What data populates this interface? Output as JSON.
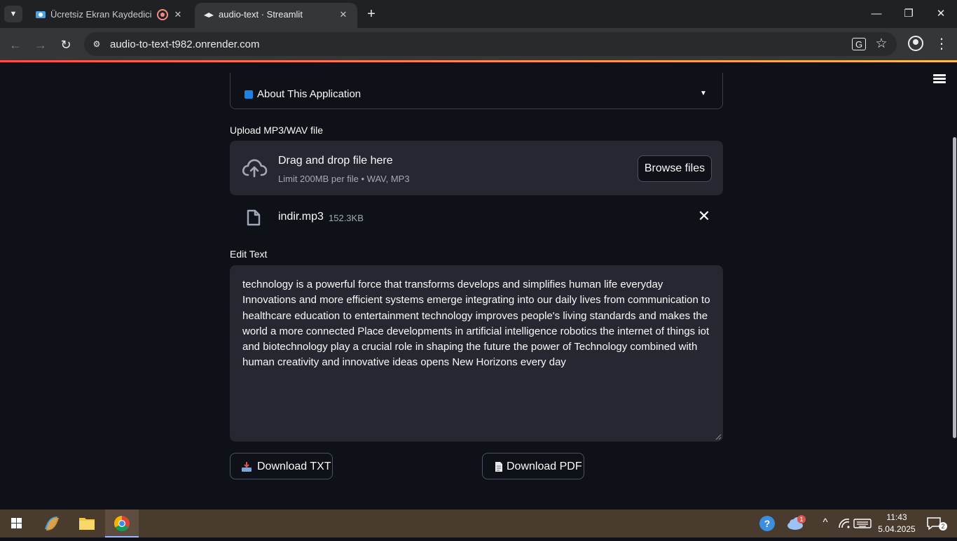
{
  "browser": {
    "tabs": [
      {
        "title": "Ücretsiz Ekran Kaydedici – V",
        "active": false
      },
      {
        "title": "audio-text · Streamlit",
        "active": true
      }
    ],
    "url": "audio-to-text-t982.onrender.com"
  },
  "app": {
    "expander_label": "About This Application",
    "upload": {
      "label": "Upload MP3/WAV file",
      "drop_title": "Drag and drop file here",
      "drop_hint": "Limit 200MB per file • WAV, MP3",
      "browse_label": "Browse files"
    },
    "file": {
      "name": "indir.mp3",
      "size": "152.3KB"
    },
    "edit": {
      "label": "Edit Text",
      "value": "technology is a powerful force that transforms develops and simplifies human life everyday Innovations and more efficient systems emerge integrating into our daily lives from communication to healthcare education to entertainment technology improves people's living standards and makes the world a more connected Place developments in artificial intelligence robotics the internet of things iot and biotechnology play a crucial role in shaping the future the power of Technology combined with human creativity and innovative ideas opens New Horizons every day"
    },
    "buttons": {
      "download_txt": "Download TXT",
      "download_pdf": "Download PDF"
    }
  },
  "taskbar": {
    "time": "11:43",
    "date": "5.04.2025",
    "notification_count": "2",
    "weather_badge": "1"
  },
  "colors": {
    "accent_red": "#ff4b4b",
    "accent_yellow": "#ffbd45",
    "background": "#0e1117",
    "widget_bg": "#262730"
  }
}
